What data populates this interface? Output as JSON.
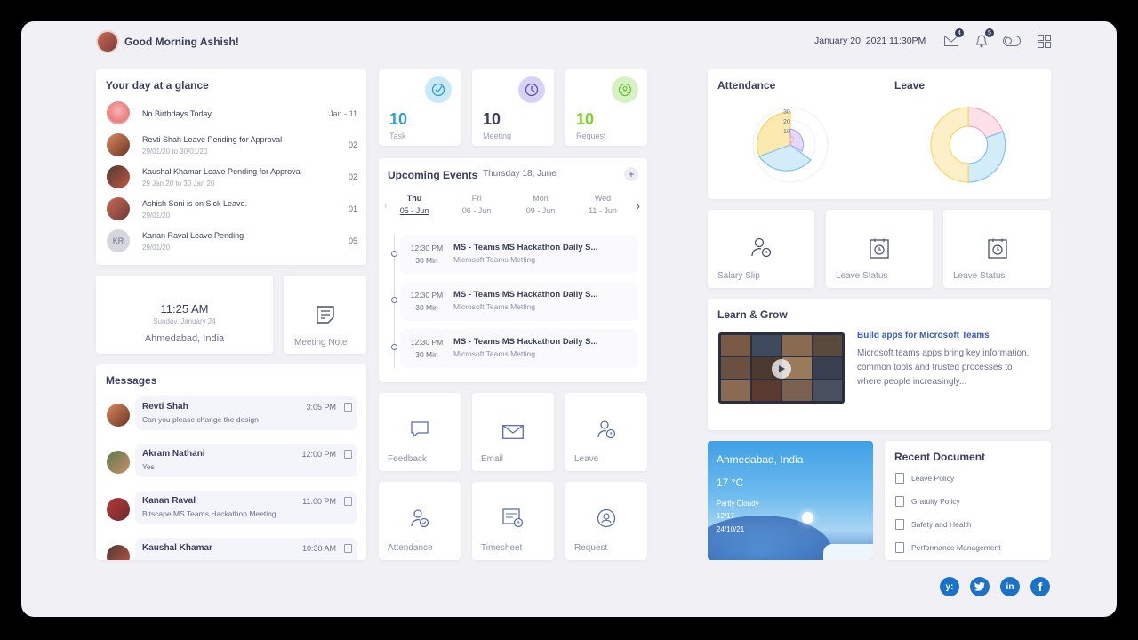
{
  "header": {
    "greeting": "Good Morning Ashish!",
    "datetime": "January 20, 2021 11:30PM",
    "mail_badge": "4",
    "bell_badge": "5"
  },
  "glance": {
    "title": "Your day at a glance",
    "items": [
      {
        "text": "No Birthdays Today",
        "sub": "",
        "right": "Jan - 11"
      },
      {
        "text": "Revti Shah Leave Pending for Approval",
        "sub": "29/01/20 to 30/01/20",
        "right": "02"
      },
      {
        "text": "Kaushal Khamar Leave Pending for Approval",
        "sub": "29 Jan 20 to 30 Jan 20",
        "right": "02"
      },
      {
        "text": "Ashish Soni is on Sick Leave.",
        "sub": "29/01/20",
        "right": "01"
      },
      {
        "text": "Kanan Raval Leave Pending",
        "sub": "29/01/20",
        "right": "05",
        "initials": "KR"
      }
    ]
  },
  "stats": [
    {
      "value": "10",
      "label": "Task",
      "color": "#2d9cdb"
    },
    {
      "value": "10",
      "label": "Meeting",
      "color": "#3a3f5c"
    },
    {
      "value": "10",
      "label": "Request",
      "color": "#7ed321"
    }
  ],
  "clock": {
    "time": "11:25 AM",
    "date": "Sunday, January 24",
    "location": "Ahmedabad, India"
  },
  "meeting_note": {
    "label": "Meeting Note"
  },
  "events": {
    "title": "Upcoming Events",
    "date": "Thursday 18, June",
    "days": [
      {
        "name": "Thu",
        "date": "05 - Jun"
      },
      {
        "name": "Fri",
        "date": "06 - Jun"
      },
      {
        "name": "Mon",
        "date": "09 - Jun"
      },
      {
        "name": "Wed",
        "date": "11 - Jun"
      }
    ],
    "items": [
      {
        "time": "12:30 PM",
        "dur": "30 Min",
        "title": "MS - Teams MS Hackathon Daily S...",
        "sub": "Microsoft Teams Metting"
      },
      {
        "time": "12:30 PM",
        "dur": "30 Min",
        "title": "MS - Teams MS Hackathon Daily S...",
        "sub": "Microsoft Teams Metting"
      },
      {
        "time": "12:30 PM",
        "dur": "30 Min",
        "title": "MS - Teams MS Hackathon Daily S...",
        "sub": "Microsoft Teams Metting"
      }
    ]
  },
  "messages": {
    "title": "Messages",
    "items": [
      {
        "name": "Revti Shah",
        "text": "Can you please change the design",
        "time": "3:05 PM"
      },
      {
        "name": "Akram Nathani",
        "text": "Yes",
        "time": "12:00 PM"
      },
      {
        "name": "Kanan Raval",
        "text": "Bitscape MS Teams Hackathon Meeting",
        "time": "11:00 PM"
      },
      {
        "name": "Kaushal Khamar",
        "text": "",
        "time": "10:30 AM"
      }
    ]
  },
  "tiles_row1": [
    "Feedback",
    "Email",
    "Leave"
  ],
  "tiles_row2": [
    "Attendance",
    "Timesheet",
    "Request"
  ],
  "attendance": {
    "title": "Attendance",
    "ticks": [
      "30",
      "20",
      "10"
    ]
  },
  "leave": {
    "title": "Leave"
  },
  "right_tiles": [
    "Salary Slip",
    "Leave Status",
    "Leave Status"
  ],
  "learn": {
    "title": "Learn & Grow",
    "heading": "Build apps for Microsoft Teams",
    "body": "Microsoft teams apps bring key information, common tools and trusted processes to where people increasingly..."
  },
  "weather": {
    "city": "Ahmedabad, India",
    "temp": "17 °C",
    "condition": "Partly Cloudy",
    "time": "12/17",
    "date": "24/10/21"
  },
  "documents": {
    "title": "Recent Document",
    "items": [
      "Leave Policy",
      "Gratuity Policy",
      "Safety and Health",
      "Performance Management"
    ]
  },
  "social": [
    "Yammer",
    "Twitter",
    "LinkedIn",
    "Facebook"
  ],
  "colors": {
    "accent": "#3a3f5c",
    "yellow": "#f5d66b",
    "blue": "#7cc4f0",
    "pink": "#f4a7b9",
    "purple": "#b9a7f2"
  }
}
